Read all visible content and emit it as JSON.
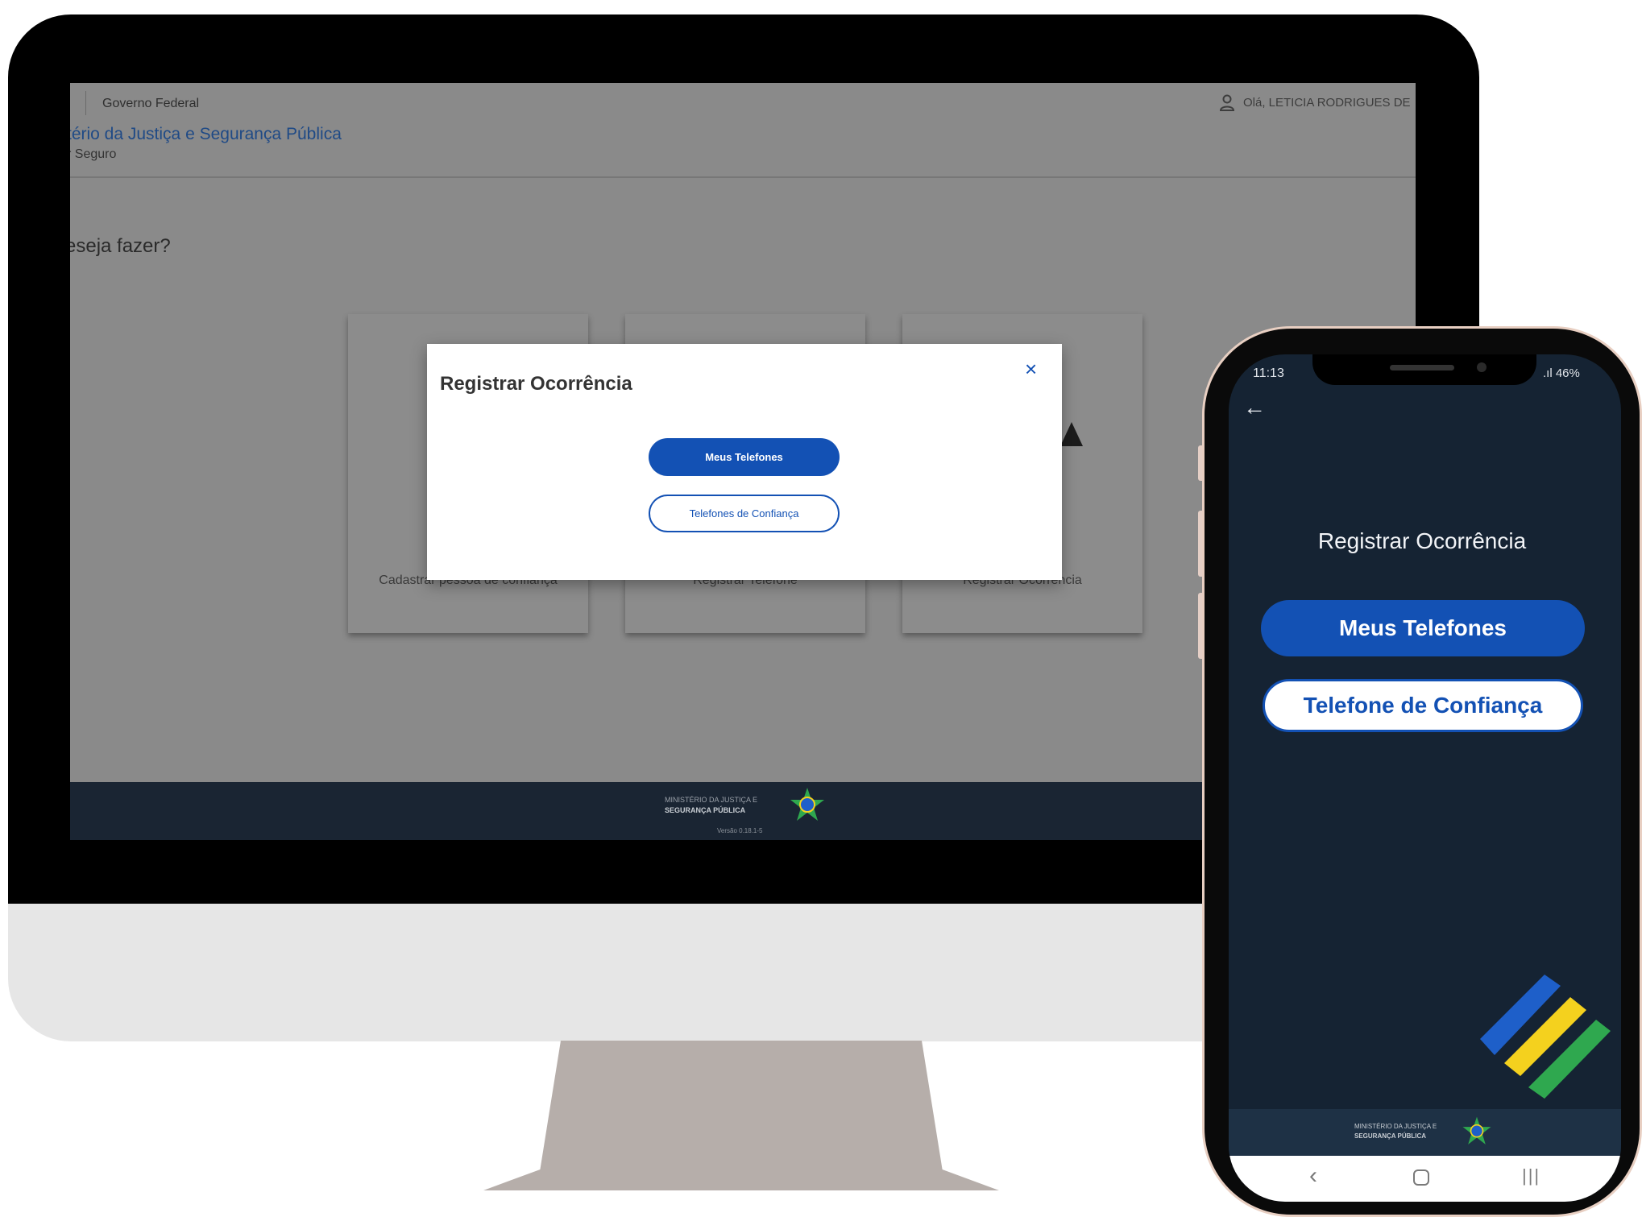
{
  "desktop": {
    "header": {
      "gov_label": "Governo Federal",
      "user_greeting": "Olá, LETICIA RODRIGUES DE",
      "ministry_title": "tério da Justiça e Segurança Pública",
      "subtitle": "r Seguro"
    },
    "question": "eseja fazer?",
    "cards": [
      {
        "label": "Cadastrar pessoa de confiança"
      },
      {
        "label": "Registrar Telefone"
      },
      {
        "label": "Registrar Ocorrência"
      }
    ],
    "modal": {
      "title": "Registrar Ocorrência",
      "close_icon": "×",
      "primary_button": "Meus Telefones",
      "secondary_button": "Telefones de Confiança"
    },
    "footer": {
      "ministry_line1": "MINISTÉRIO DA JUSTIÇA E",
      "ministry_line2": "SEGURANÇA PÚBLICA",
      "version": "Versão 0.18.1-5"
    }
  },
  "phone": {
    "status": {
      "time": "11:13",
      "battery": ".ıl 46%"
    },
    "back_icon": "←",
    "title": "Registrar Ocorrência",
    "primary_button": "Meus Telefones",
    "secondary_button": "Telefone de Confiança",
    "footer": {
      "ministry_line1": "MINISTÉRIO DA JUSTIÇA E",
      "ministry_line2": "SEGURANÇA PÚBLICA"
    },
    "nav": {
      "back": "‹",
      "recent": "|||"
    }
  },
  "colors": {
    "primary": "#1351b4",
    "app_background": "#152333",
    "footer": "#1a2533",
    "brand_blue": "#1e5fc9",
    "brand_yellow": "#f4d11e",
    "brand_green": "#2fa84f"
  }
}
